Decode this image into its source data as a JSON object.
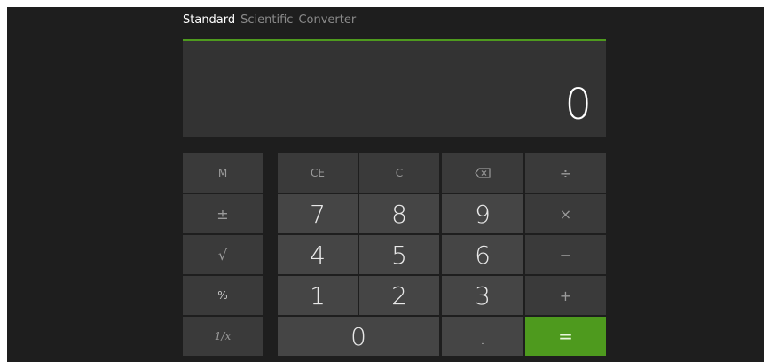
{
  "tabs": [
    {
      "label": "Standard",
      "active": true
    },
    {
      "label": "Scientific",
      "active": false
    },
    {
      "label": "Converter",
      "active": false
    }
  ],
  "display": {
    "value": "0"
  },
  "keys": {
    "memory": "M",
    "ce": "CE",
    "clear": "C",
    "backspace": "backspace-icon",
    "divide": "÷",
    "plus_minus": "±",
    "sqrt": "√",
    "percent": "%",
    "reciprocal": "1/x",
    "multiply": "×",
    "subtract": "−",
    "add": "+",
    "equals": "=",
    "decimal": ".",
    "digits": {
      "0": "0",
      "1": "1",
      "2": "2",
      "3": "3",
      "4": "4",
      "5": "5",
      "6": "6",
      "7": "7",
      "8": "8",
      "9": "9"
    }
  },
  "colors": {
    "background": "#1e1e1e",
    "display": "#333333",
    "accent": "#4e9a1e",
    "number_key": "#454545",
    "function_key": "#3a3a3a"
  }
}
